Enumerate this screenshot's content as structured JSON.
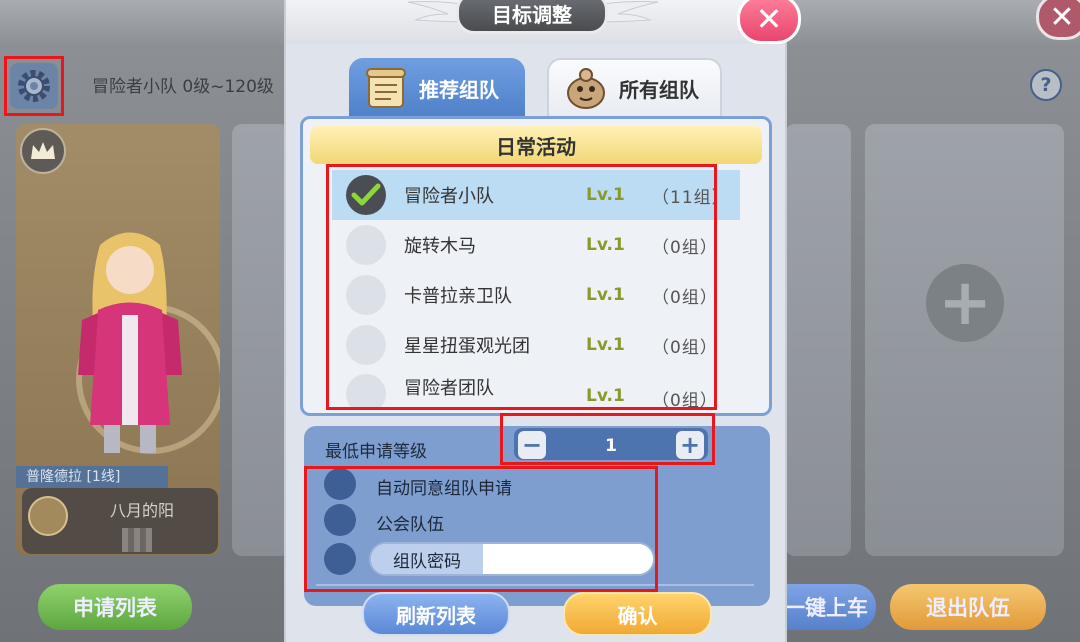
{
  "background": {
    "subtitle": "冒险者小队  0级~120级",
    "player_card": {
      "name_strip": "普隆德拉  [1线]",
      "player_name": "八月的阳"
    },
    "buttons": {
      "apply_list": "申请列表",
      "quick_join": "一键上车",
      "leave_team": "退出队伍"
    },
    "help_glyph": "?"
  },
  "dialog": {
    "title": "目标调整",
    "close_glyph": "✕",
    "tabs": [
      {
        "label": "推荐组队",
        "icon": "scroll-icon",
        "active": true
      },
      {
        "label": "所有组队",
        "icon": "poring-icon",
        "active": false
      }
    ],
    "category": "日常活动",
    "activities": [
      {
        "name": "冒险者小队",
        "level": "Lv.1",
        "count": "（11组）",
        "selected": true
      },
      {
        "name": "旋转木马",
        "level": "Lv.1",
        "count": "（0组）",
        "selected": false
      },
      {
        "name": "卡普拉亲卫队",
        "level": "Lv.1",
        "count": "（0组）",
        "selected": false
      },
      {
        "name": "星星扭蛋观光团",
        "level": "Lv.1",
        "count": "（0组）",
        "selected": false
      },
      {
        "name": "冒险者团队",
        "level": "Lv.1",
        "count": "（0组）",
        "selected": false
      }
    ],
    "min_level": {
      "label": "最低申请等级",
      "value": "1",
      "minus": "−",
      "plus": "+"
    },
    "options": {
      "auto_accept": "自动同意组队申请",
      "guild_team": "公会队伍",
      "password_label": "组队密码",
      "password_value": ""
    },
    "footer": {
      "refresh": "刷新列表",
      "confirm": "确认"
    }
  },
  "colors": {
    "accent_blue": "#4f80c9",
    "confirm_orange": "#f0a936",
    "close_pink": "#e9456d",
    "level_green": "#8a9a2a",
    "highlight_red": "#e8171e"
  }
}
